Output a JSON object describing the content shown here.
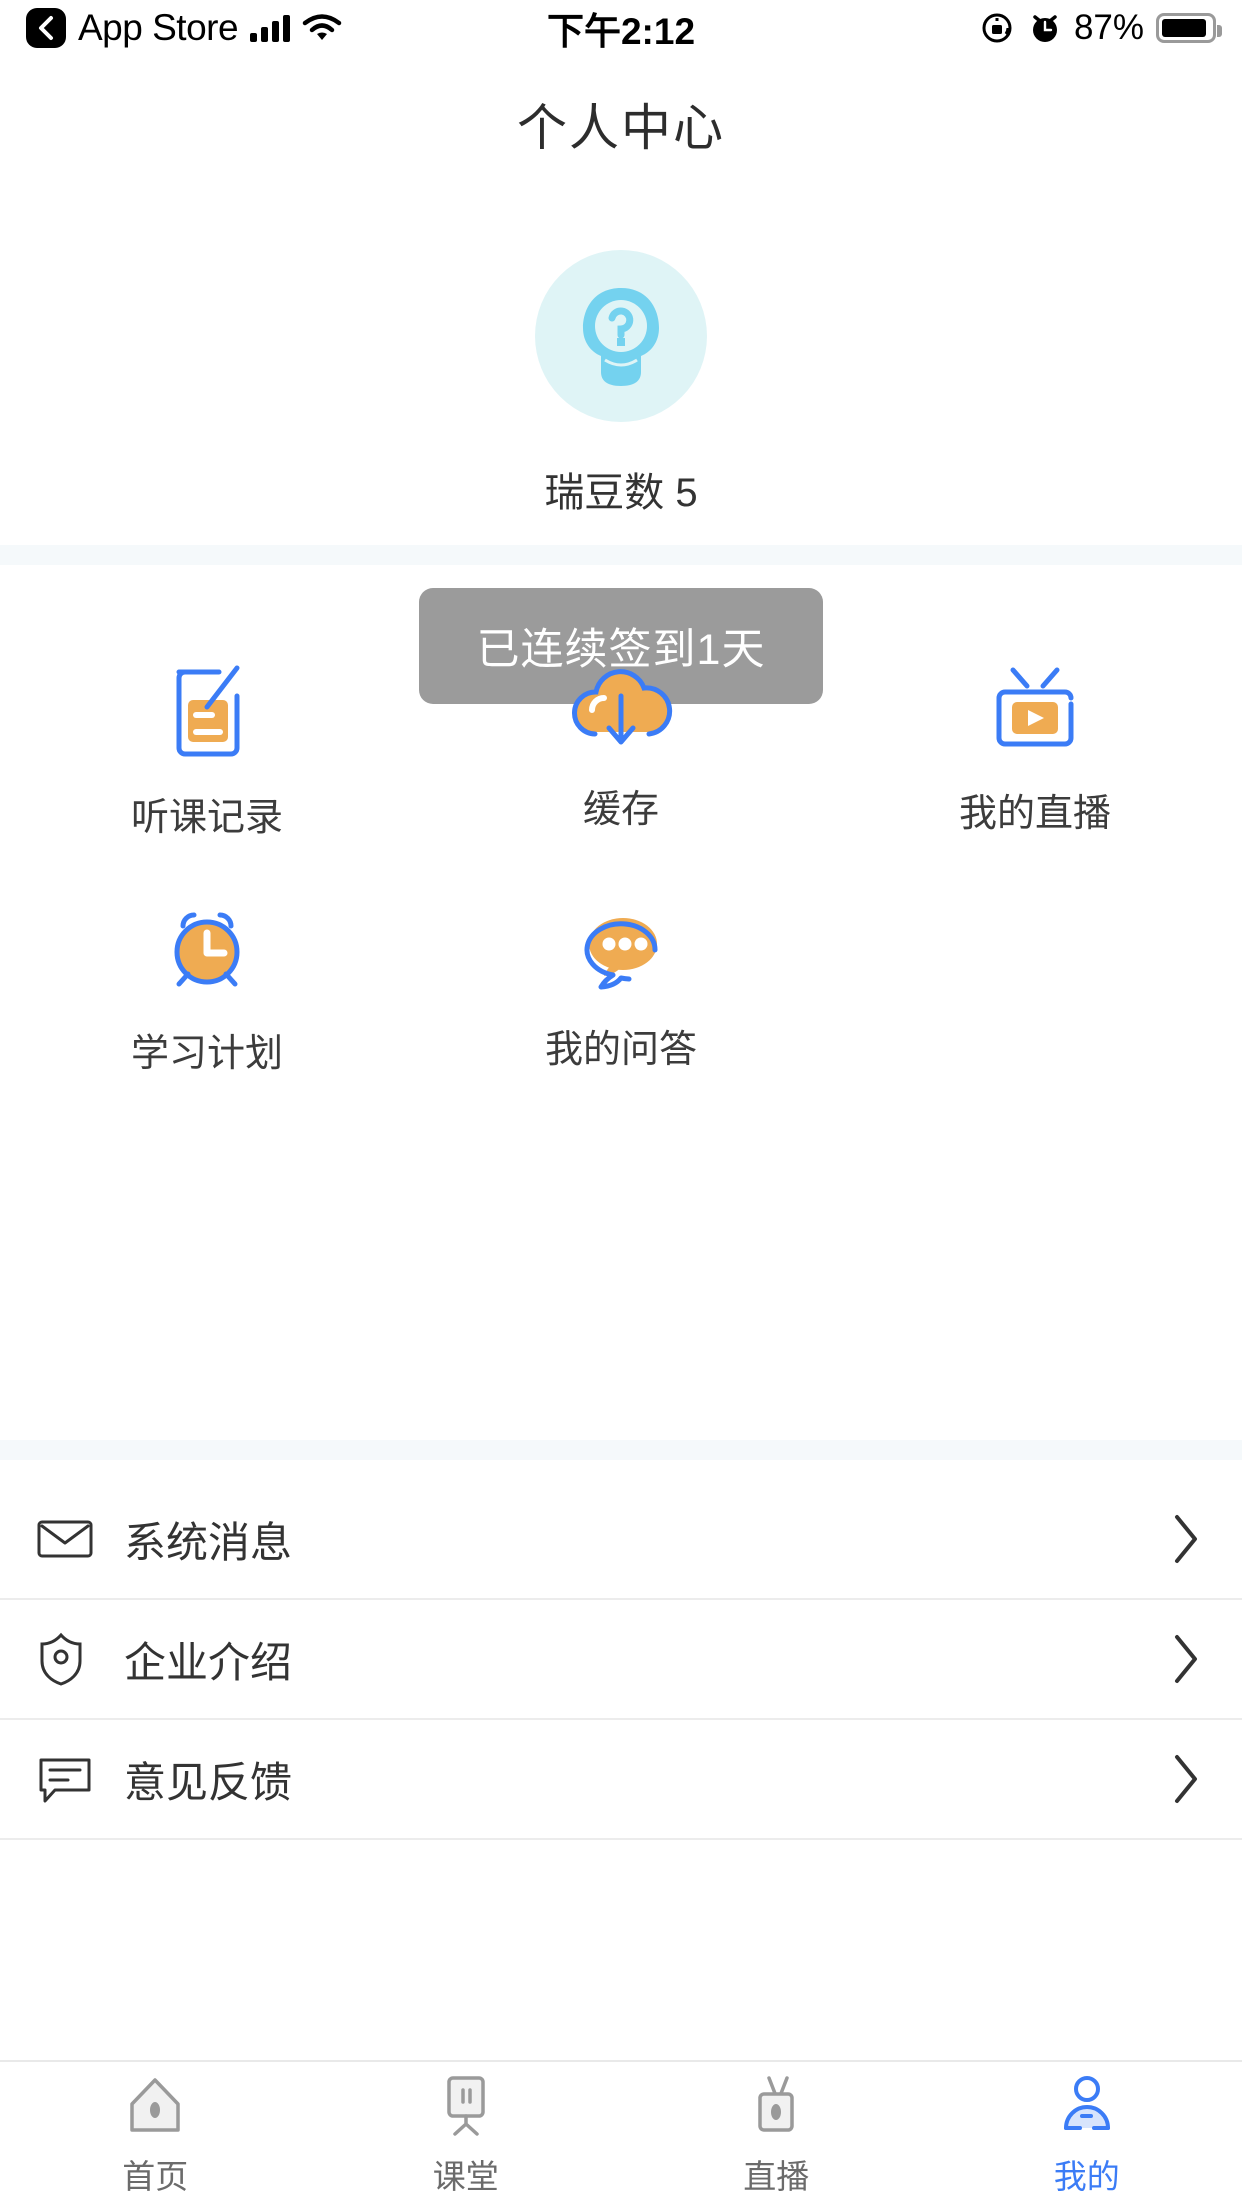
{
  "statusbar": {
    "back_label": "App Store",
    "back_icon": "chevron-left-icon",
    "signal_icon": "cellular-signal-icon",
    "wifi_icon": "wifi-icon",
    "time": "下午2:12",
    "rotation_lock_icon": "rotation-lock-icon",
    "alarm_icon": "alarm-clock-icon",
    "battery_percent": "87%",
    "battery_icon": "battery-icon"
  },
  "header": {
    "title": "个人中心"
  },
  "profile": {
    "avatar_icon": "avatar-question-icon",
    "beans_label": "瑞豆数 5",
    "signin_label": "已连续签到1天",
    "signin_bg": "#9b9b9b"
  },
  "grid": {
    "rows": [
      [
        {
          "label": "听课记录",
          "icon": "notebook-pen-icon"
        },
        {
          "label": "缓存",
          "icon": "cloud-download-icon"
        },
        {
          "label": "我的直播",
          "icon": "tv-play-icon"
        }
      ],
      [
        {
          "label": "学习计划",
          "icon": "alarm-clock-icon"
        },
        {
          "label": "我的问答",
          "icon": "chat-bubble-dots-icon"
        },
        {
          "label": "",
          "icon": ""
        }
      ]
    ]
  },
  "list": {
    "items": [
      {
        "label": "系统消息",
        "icon": "envelope-icon",
        "chevron": "chevron-right-icon"
      },
      {
        "label": "企业介绍",
        "icon": "shield-icon",
        "chevron": "chevron-right-icon"
      },
      {
        "label": "意见反馈",
        "icon": "feedback-comment-icon",
        "chevron": "chevron-right-icon"
      }
    ]
  },
  "tabbar": {
    "active_color": "#3b7cf6",
    "inactive_color": "#9a9a9a",
    "items": [
      {
        "label": "首页",
        "icon": "home-icon",
        "active": false
      },
      {
        "label": "课堂",
        "icon": "classroom-board-icon",
        "active": false
      },
      {
        "label": "直播",
        "icon": "live-tv-icon",
        "active": false
      },
      {
        "label": "我的",
        "icon": "person-icon",
        "active": true
      }
    ]
  },
  "colors": {
    "accent_blue": "#3b7cf6",
    "accent_orange": "#efab52",
    "avatar_bg": "#dff4f6",
    "avatar_fg": "#74d2ef",
    "section_bg": "#f5f9fb"
  }
}
